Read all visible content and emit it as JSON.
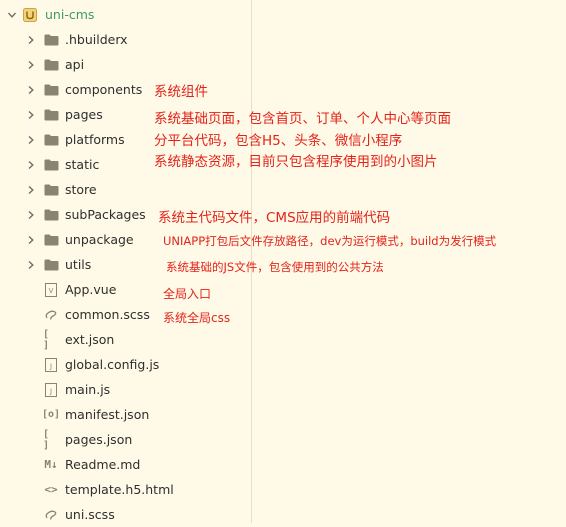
{
  "root": {
    "label": "uni-cms",
    "icon": "uni-app-logo-icon"
  },
  "folders": [
    {
      "name": "folder-hbuilderx",
      "label": ".hbuilderx"
    },
    {
      "name": "folder-api",
      "label": "api"
    },
    {
      "name": "folder-components",
      "label": "components"
    },
    {
      "name": "folder-pages",
      "label": "pages"
    },
    {
      "name": "folder-platforms",
      "label": "platforms"
    },
    {
      "name": "folder-static",
      "label": "static"
    },
    {
      "name": "folder-store",
      "label": "store"
    },
    {
      "name": "folder-subpackages",
      "label": "subPackages"
    },
    {
      "name": "folder-unpackage",
      "label": "unpackage"
    },
    {
      "name": "folder-utils",
      "label": "utils"
    }
  ],
  "files": [
    {
      "name": "file-app-vue",
      "label": "App.vue",
      "icon": "vue-file-icon"
    },
    {
      "name": "file-common-scss",
      "label": "common.scss",
      "icon": "scss-file-icon"
    },
    {
      "name": "file-ext-json",
      "label": "ext.json",
      "icon": "json-file-icon"
    },
    {
      "name": "file-global-config-js",
      "label": "global.config.js",
      "icon": "js-file-icon"
    },
    {
      "name": "file-main-js",
      "label": "main.js",
      "icon": "js-file-icon"
    },
    {
      "name": "file-manifest-json",
      "label": "manifest.json",
      "icon": "manifest-file-icon"
    },
    {
      "name": "file-pages-json",
      "label": "pages.json",
      "icon": "json-file-icon"
    },
    {
      "name": "file-readme-md",
      "label": "Readme.md",
      "icon": "markdown-file-icon"
    },
    {
      "name": "file-template-h5-html",
      "label": "template.h5.html",
      "icon": "html-file-icon"
    },
    {
      "name": "file-uni-scss",
      "label": "uni.scss",
      "icon": "scss-file-icon"
    }
  ],
  "annotations": {
    "components": "系统组件",
    "pages": "系统基础页面，包含首页、订单、个人中心等页面",
    "platforms": "分平台代码，包含H5、头条、微信小程序",
    "static": "系统静态资源，目前只包含程序使用到的小图片",
    "subPackages": "系统主代码文件，CMS应用的前端代码",
    "unpackage": "UNIAPP打包后文件存放路径，dev为运行模式，build为发行模式",
    "utils": "系统基础的JS文件，包含使用到的公共方法",
    "app_vue": "全局入口",
    "common_scss": "系统全局css"
  },
  "colors": {
    "background": "#fffae8",
    "annotation": "#e2231a",
    "root_label": "#3c9a66",
    "folder": "#8a8370"
  }
}
